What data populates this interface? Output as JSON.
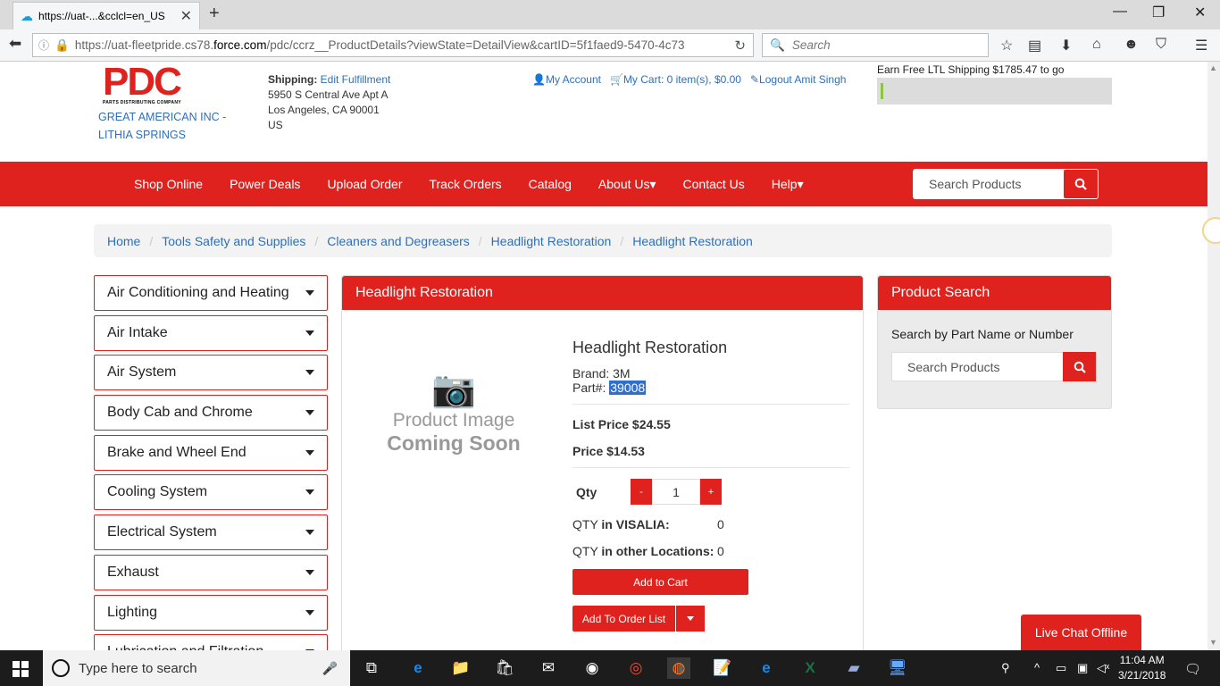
{
  "browser": {
    "tab_title": "https://uat-...&cclcl=en_US",
    "url_prefix": "https://uat-fleetpride.cs78.",
    "url_domain": "force.com",
    "url_suffix": "/pdc/ccrz__ProductDetails?viewState=DetailView&cartID=5f1faed9-5470-4c73",
    "search_placeholder": "Search"
  },
  "header": {
    "logo_text": "PDC",
    "logo_subtext": "PARTS DISTRIBUTING COMPANY",
    "company_line1": "GREAT AMERICAN INC -",
    "company_line2": "LITHIA SPRINGS",
    "shipping_label": "Shipping:",
    "shipping_link": "Edit Fulfillment",
    "address1": "5950 S Central Ave Apt A",
    "address2": "Los Angeles, CA 90001",
    "address3": "US",
    "my_account": "My Account",
    "my_cart": "My Cart: 0 item(s), $0.00",
    "logout": "Logout Amit Singh",
    "ltl_text": "Earn Free LTL Shipping $1785.47 to go",
    "ltl_progress": 0.01
  },
  "menu": {
    "items": [
      "Shop Online",
      "Power Deals",
      "Upload Order",
      "Track Orders",
      "Catalog",
      "About Us▾",
      "Contact Us",
      "Help▾"
    ],
    "search_placeholder": "Search Products"
  },
  "breadcrumb": [
    "Home",
    "Tools Safety and Supplies",
    "Cleaners and Degreasers",
    "Headlight Restoration",
    "Headlight Restoration"
  ],
  "categories": [
    "Air Conditioning and Heating",
    "Air Intake",
    "Air System",
    "Body Cab and Chrome",
    "Brake and Wheel End",
    "Cooling System",
    "Electrical System",
    "Exhaust",
    "Lighting",
    "Lubrication and Filtration"
  ],
  "product": {
    "panel_title": "Headlight Restoration",
    "image_line1": "Product Image",
    "image_line2": "Coming Soon",
    "name": "Headlight Restoration",
    "brand": "Brand: 3M",
    "part_label": "Part#:",
    "part_number": "39008",
    "list_price": "List Price $24.55",
    "price": "Price $14.53",
    "qty_label": "Qty",
    "qty_minus": "-",
    "qty_value": "1",
    "qty_plus": "+",
    "inv1_label_a": "QTY ",
    "inv1_label_b": "in VISALIA:",
    "inv1_value": "0",
    "inv2_label_a": "QTY ",
    "inv2_label_b": "in other Locations:",
    "inv2_value": "0",
    "add_to_cart": "Add to Cart",
    "add_to_order_list": "Add To Order List"
  },
  "product_search": {
    "title": "Product Search",
    "label": "Search by Part Name or Number",
    "placeholder": "Search Products"
  },
  "chat": "Live Chat Offline",
  "taskbar": {
    "search_placeholder": "Type here to search",
    "time": "11:04 AM",
    "date": "3/21/2018"
  },
  "colors": {
    "brand_red": "#e0221e",
    "link_blue": "#2f6fb7"
  }
}
